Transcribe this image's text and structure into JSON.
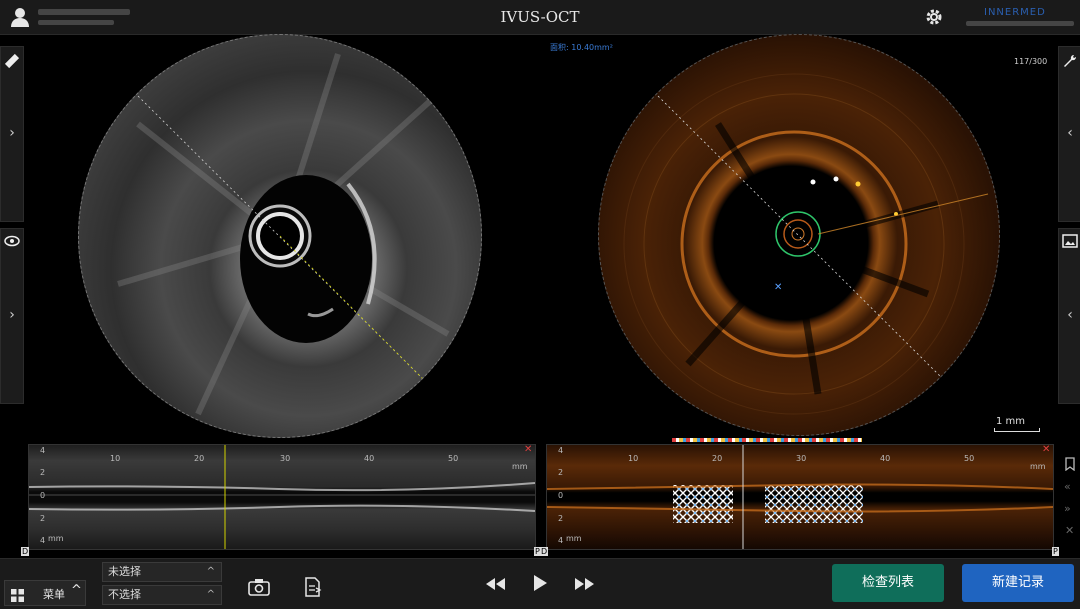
{
  "app": {
    "title": "IVUS-OCT"
  },
  "measurement": {
    "area_label": "面积: 10.40mm²",
    "frame_counter": "117/300",
    "scale_label": "1 mm"
  },
  "lview": {
    "mm_label": "mm",
    "x_ticks": [
      "10",
      "20",
      "30",
      "40",
      "50"
    ],
    "y_ticks": [
      "4",
      "2",
      "0",
      "2",
      "4"
    ],
    "left_y_units": "mm",
    "left_marker_start": "D",
    "left_marker_end": "P",
    "right_marker_start": "D",
    "right_marker_end": "P"
  },
  "bottom": {
    "menu_label": "菜单",
    "select1": "未选择",
    "select2": "不选择",
    "btn_exam_list": "检查列表",
    "btn_new_record": "新建记录"
  },
  "icons": {
    "user": "user-icon",
    "settings": "gear-icon",
    "ruler": "ruler-icon",
    "eye": "eye-icon",
    "wrench": "wrench-icon",
    "image": "image-icon",
    "camera": "camera-icon",
    "export": "export-icon",
    "rewind": "rewind-icon",
    "play": "play-icon",
    "fast_forward": "fast-forward-icon"
  },
  "colors": {
    "green_button": "#0f6e5a",
    "blue_button": "#1f64c0",
    "accent_blue": "#3a7bd5",
    "brand": "#2a5fb0"
  }
}
